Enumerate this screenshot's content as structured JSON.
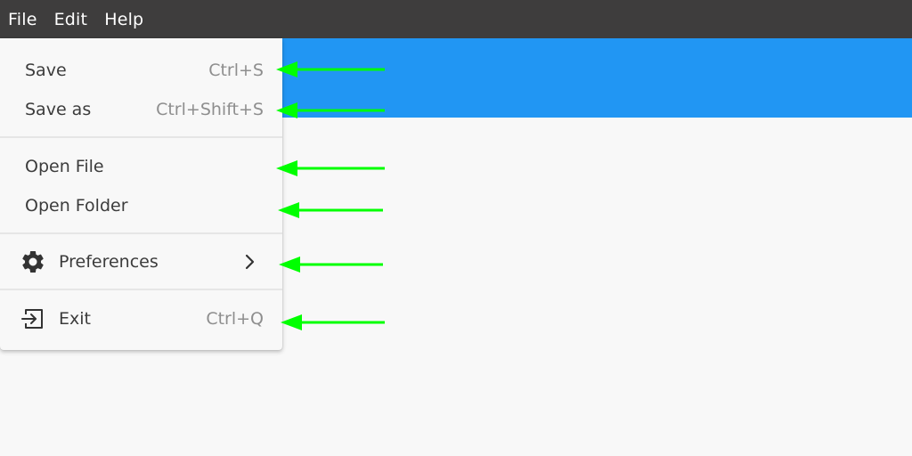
{
  "menubar": {
    "items": [
      "File",
      "Edit",
      "Help"
    ]
  },
  "file_menu": {
    "save": {
      "label": "Save",
      "shortcut": "Ctrl+S"
    },
    "save_as": {
      "label": "Save as",
      "shortcut": "Ctrl+Shift+S"
    },
    "open_file": {
      "label": "Open File"
    },
    "open_folder": {
      "label": "Open Folder"
    },
    "preferences": {
      "label": "Preferences",
      "icon": "gear-icon",
      "submenu_icon": "chevron-right-icon"
    },
    "exit": {
      "label": "Exit",
      "shortcut": "Ctrl+Q",
      "icon": "exit-icon"
    }
  },
  "colors": {
    "menubar_bg": "#3e3d3d",
    "accent_band": "#2196f3",
    "annotation_arrow": "#00ff00"
  }
}
